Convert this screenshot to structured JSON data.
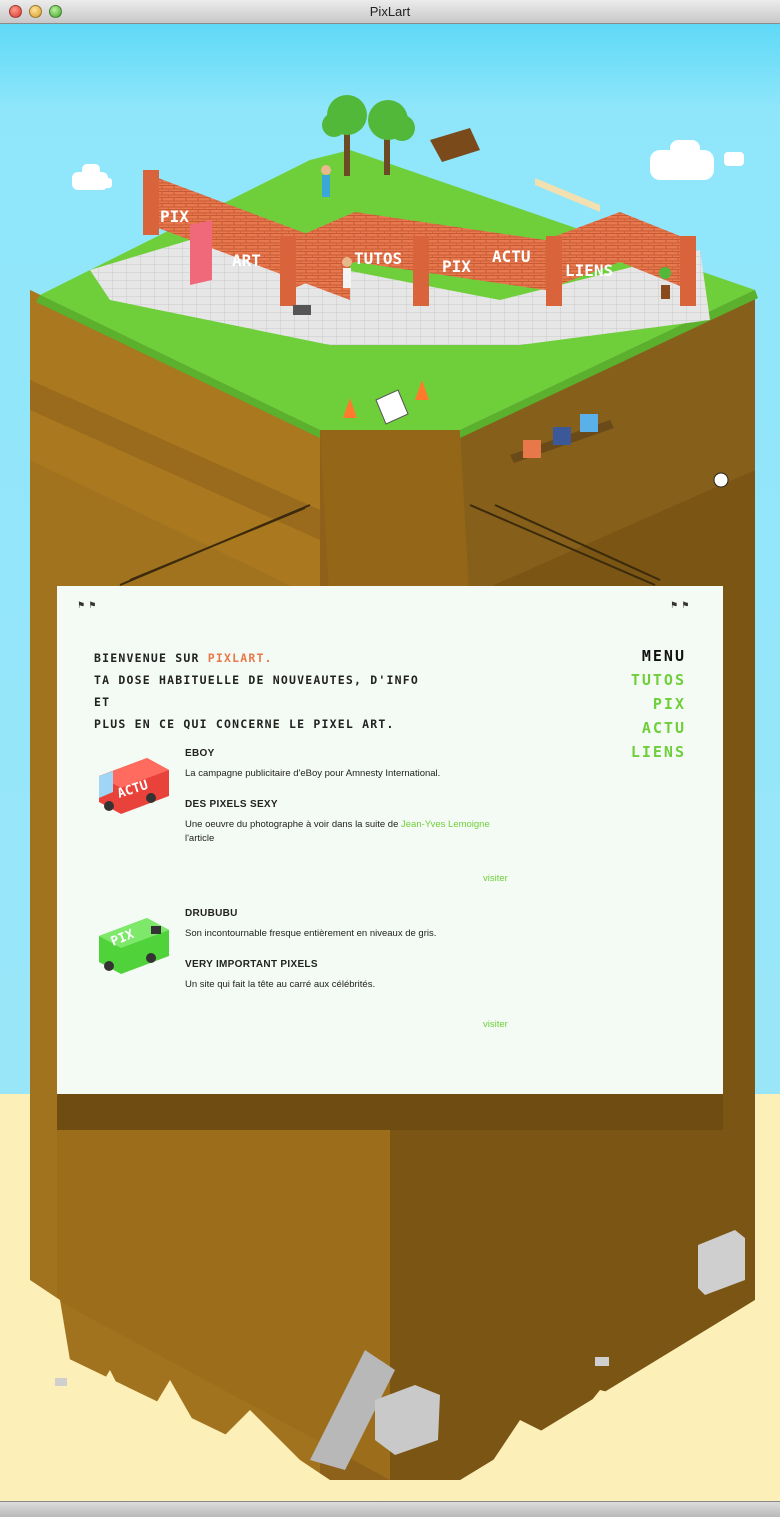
{
  "window": {
    "title": "PixLart"
  },
  "signs": [
    "PIX",
    "ART",
    "TUTOS",
    "PIX",
    "ACTU",
    "LIENS"
  ],
  "intro": {
    "prefix": "Bienvenue sur ",
    "brand": "PixLart.",
    "line2": "Ta dose habituelle de nouveautes, d'info et",
    "line3": "plus en ce qui concerne le pixel art."
  },
  "menu": {
    "title": "MENU",
    "items": [
      "TUTOS",
      "PIX",
      "ACTU",
      "LIENS"
    ]
  },
  "sections": [
    {
      "badge": "ACTU",
      "badge_color": "#e8423a",
      "items": [
        {
          "title": "EBOY",
          "text": "La campagne publicitaire d'eBoy pour Amnesty International."
        },
        {
          "title": "DES PIXELS SEXY",
          "text": "Une oeuvre du photographe à voir dans la suite de ",
          "link": "Jean-Yves Lemoigne",
          "text2": "l'article"
        }
      ],
      "visit": "visiter"
    },
    {
      "badge": "PIX",
      "badge_color": "#4fd23a",
      "items": [
        {
          "title": "DRUBUBU",
          "text": "Son incontournable fresque entièrement en niveaux de gris."
        },
        {
          "title": "VERY IMPORTANT PIXELS",
          "text": "Un site qui fait la tête au carré aux célébrités."
        }
      ],
      "visit": "visiter"
    }
  ],
  "colors": {
    "sky": "#8fe3f7",
    "grass": "#6fcf3b",
    "dirt": "#9a6b1c",
    "sand": "#fcefb8",
    "accent": "#e8784a",
    "panel": "#f4fbf4"
  }
}
